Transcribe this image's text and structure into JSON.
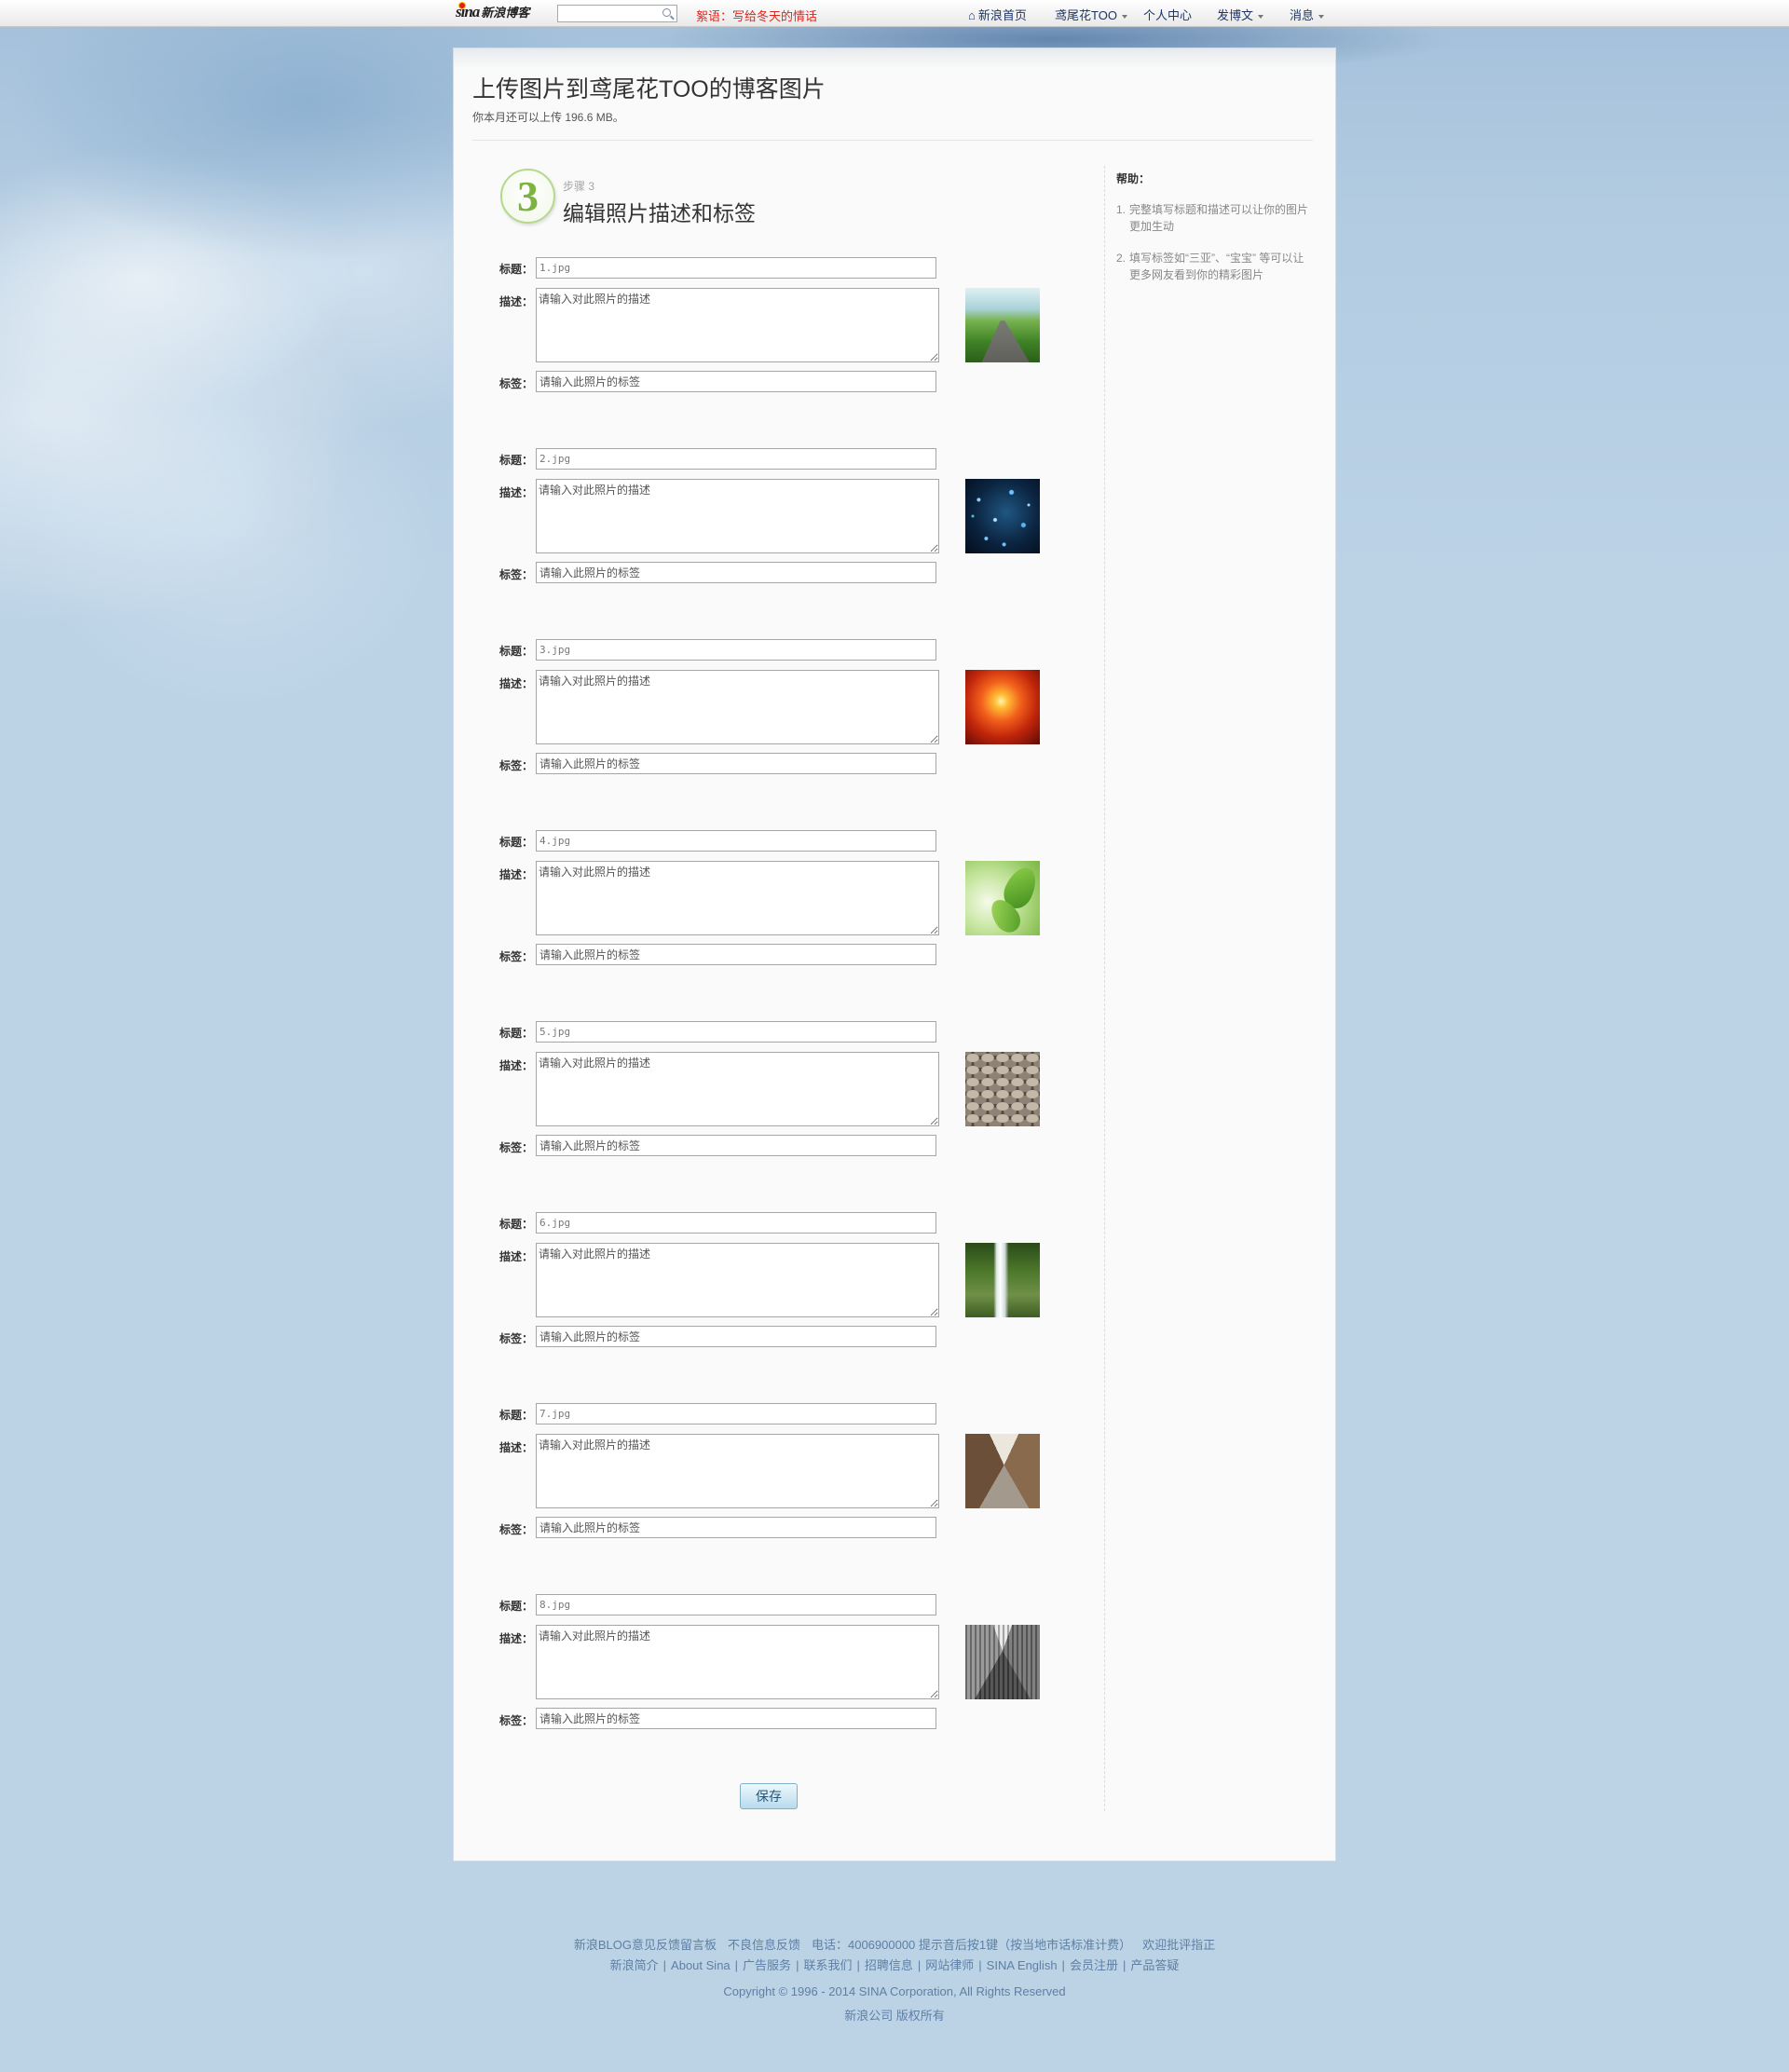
{
  "topbar": {
    "logo": "sina",
    "logo_sub": "新浪博客",
    "search_icon": "search-icon",
    "notice": "絮语：写给冬天的情话",
    "nav": [
      {
        "label": "新浪首页",
        "icon": "home-icon"
      },
      {
        "label": "鸢尾花TOO",
        "dropdown": true
      },
      {
        "label": "个人中心"
      },
      {
        "label": "发博文",
        "dropdown": true
      },
      {
        "label": "消息",
        "dropdown": true
      }
    ]
  },
  "page": {
    "title": "上传图片到鸢尾花TOO的博客图片",
    "quota": "你本月还可以上传 196.6 MB。"
  },
  "step": {
    "number": "3",
    "label": "步骤 3",
    "title": "编辑照片描述和标签"
  },
  "form": {
    "title_label": "标题：",
    "description_label": "描述：",
    "tags_label": "标签：",
    "description_placeholder": "请输入对此照片的描述",
    "tags_placeholder": "请输入此照片的标签",
    "save_label": "保存"
  },
  "photos": [
    {
      "title": "1.jpg"
    },
    {
      "title": "2.jpg"
    },
    {
      "title": "3.jpg"
    },
    {
      "title": "4.jpg"
    },
    {
      "title": "5.jpg"
    },
    {
      "title": "6.jpg"
    },
    {
      "title": "7.jpg"
    },
    {
      "title": "8.jpg"
    }
  ],
  "help": {
    "heading": "帮助：",
    "items": [
      {
        "num": "1.",
        "text": "完整填写标题和描述可以让你的图片更加生动"
      },
      {
        "num": "2.",
        "text": "填写标签如“三亚”、“宝宝” 等可以让更多网友看到你的精彩图片"
      }
    ]
  },
  "footer": {
    "feedback_board": "新浪BLOG意见反馈留言板",
    "bad_info": "不良信息反馈",
    "phone": "电话：4006900000 提示音后按1键（按当地市话标准计费）",
    "welcome": "欢迎批评指正",
    "separator": "|",
    "links": [
      "新浪简介",
      "About Sina",
      "广告服务",
      "联系我们",
      "招聘信息",
      "网站律师",
      "SINA English",
      "会员注册",
      "产品答疑"
    ],
    "copyright": "Copyright © 1996 - 2014 SINA Corporation, All Rights Reserved",
    "company": "新浪公司 版权所有"
  },
  "colors": {
    "page_background": "#bcd3e6",
    "notice_red": "#e0241c",
    "step_green": "#7cb342",
    "footer_text": "#5d7fa5"
  }
}
